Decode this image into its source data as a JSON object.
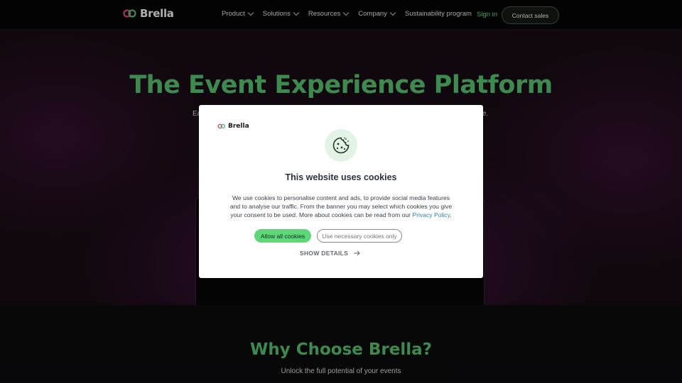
{
  "nav": {
    "brand": "Brella",
    "menu": [
      {
        "label": "Product",
        "has_dropdown": true
      },
      {
        "label": "Solutions",
        "has_dropdown": true
      },
      {
        "label": "Resources",
        "has_dropdown": true
      },
      {
        "label": "Company",
        "has_dropdown": true
      },
      {
        "label": "Sustainability program",
        "has_dropdown": false
      }
    ],
    "signin": "Sign in",
    "contact": "Contact sales"
  },
  "hero": {
    "title": "The Event Experience Platform",
    "subtitle_left_fragment": "Ea",
    "subtitle_right_fragment": "e."
  },
  "why": {
    "title": "Why Choose Brella?",
    "subtitle": "Unlock the full potential of your events"
  },
  "cookie_modal": {
    "brand": "Brella",
    "icon": "cookie-icon",
    "title": "This website uses cookies",
    "body": "We use cookies to personalise content and ads, to provide social media features and to analyse our traffic. From the banner you may select which cookies you give your consent to be used. More about cookies can be read from our",
    "link_text": "Privacy Policy",
    "body_end": ".",
    "allow_all": "Allow all cookies",
    "necessary_only": "Use necessary cookies only",
    "show_details": "SHOW DETAILS"
  },
  "colors": {
    "accent_green": "#52b86a",
    "button_green": "#5fd67a",
    "link_blue": "#2a7fb8"
  }
}
